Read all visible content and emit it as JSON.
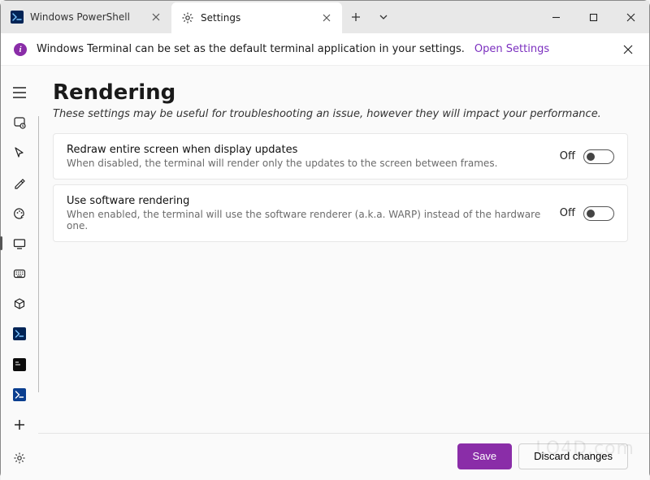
{
  "tabs": [
    {
      "title": "Windows PowerShell",
      "icon": "powershell"
    },
    {
      "title": "Settings",
      "icon": "gear"
    }
  ],
  "window": {
    "minimize": "minimize",
    "maximize": "maximize",
    "close": "close"
  },
  "infobar": {
    "text": "Windows Terminal can be set as the default terminal application in your settings.",
    "link": "Open Settings"
  },
  "page": {
    "title": "Rendering",
    "subhead": "These settings may be useful for troubleshooting an issue, however they will impact your performance."
  },
  "settings": [
    {
      "title": "Redraw entire screen when display updates",
      "desc": "When disabled, the terminal will render only the updates to the screen between frames.",
      "state_label": "Off"
    },
    {
      "title": "Use software rendering",
      "desc": "When enabled, the terminal will use the software renderer (a.k.a. WARP) instead of the hardware one.",
      "state_label": "Off"
    }
  ],
  "footer": {
    "save": "Save",
    "discard": "Discard changes"
  },
  "rail": {
    "items": [
      "hamburger",
      "startup",
      "interaction",
      "appearance",
      "colors",
      "rendering",
      "actions",
      "defaults",
      "powershell",
      "cmd",
      "azure",
      "add"
    ],
    "bottom": "settings"
  },
  "watermark": "LO4D.com"
}
